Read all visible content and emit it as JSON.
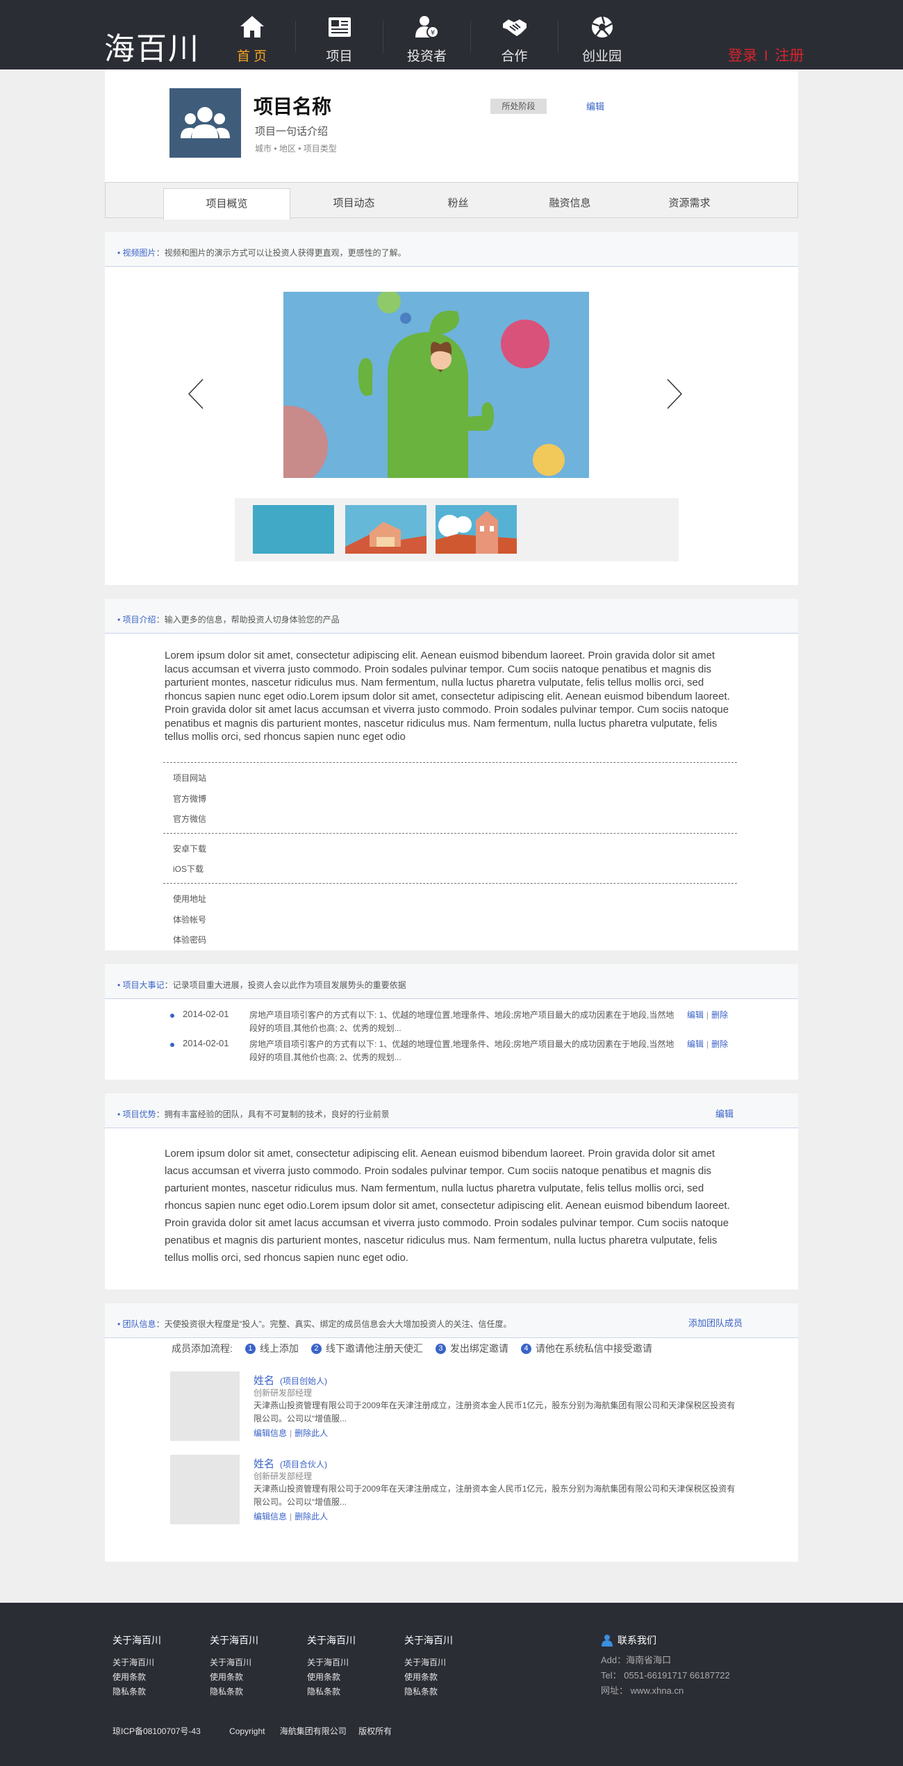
{
  "header": {
    "logo": "海百川",
    "nav": [
      {
        "label": "首 页",
        "icon": "home-icon",
        "active": true
      },
      {
        "label": "项目",
        "icon": "newspaper-icon",
        "active": false
      },
      {
        "label": "投资者",
        "icon": "investor-icon",
        "active": false
      },
      {
        "label": "合作",
        "icon": "handshake-icon",
        "active": false
      },
      {
        "label": "创业园",
        "icon": "aperture-icon",
        "active": false
      }
    ],
    "login": "登录",
    "divider": "I",
    "register": "注册"
  },
  "project": {
    "name": "项目名称",
    "slogan": "项目一句话介绍",
    "meta": "城市 • 地区 • 项目类型",
    "stage": "所处阶段",
    "edit": "编辑"
  },
  "tabs": [
    "项目概览",
    "项目动态",
    "粉丝",
    "融资信息",
    "资源需求"
  ],
  "media": {
    "title": "视频图片",
    "hint": "：视频和图片的演示方式可以让投资人获得更直观，更感性的了解。"
  },
  "intro": {
    "title": "项目介绍",
    "hint": "：输入更多的信息，帮助投资人切身体验您的产品",
    "body": "Lorem ipsum dolor sit amet, consectetur adipiscing elit. Aenean euismod bibendum laoreet. Proin gravida dolor sit amet lacus accumsan et viverra justo commodo. Proin sodales pulvinar tempor. Cum sociis natoque penatibus et magnis dis parturient montes, nascetur ridiculus mus. Nam fermentum, nulla luctus pharetra vulputate, felis tellus mollis orci, sed rhoncus sapien nunc eget odio.Lorem ipsum dolor sit amet, consectetur adipiscing elit. Aenean euismod bibendum laoreet. Proin gravida dolor sit amet lacus accumsan et viverra justo commodo. Proin sodales pulvinar tempor. Cum sociis natoque penatibus et magnis dis parturient montes, nascetur ridiculus mus. Nam fermentum, nulla luctus pharetra vulputate, felis tellus mollis orci, sed rhoncus sapien nunc eget odio",
    "link_groups": [
      [
        "项目网站",
        "官方微博",
        "官方微信"
      ],
      [
        "安卓下载",
        "iOS下载"
      ],
      [
        "使用地址",
        "体验帐号",
        "体验密码"
      ]
    ]
  },
  "events": {
    "title": "项目大事记",
    "hint": "：记录项目重大进展，投资人会以此作为项目发展势头的重要依据",
    "items": [
      {
        "date": "2014-02-01",
        "text": "房地产项目项引客户的方式有以下: 1、优越的地理位置,地理条件、地段;房地产项目最大的成功因素在于地段,当然地段好的项目,其他价也高; 2、优秀的规划...",
        "edit": "编辑",
        "sep": "|",
        "delete": "删除"
      },
      {
        "date": "2014-02-01",
        "text": "房地产项目项引客户的方式有以下: 1、优越的地理位置,地理条件、地段;房地产项目最大的成功因素在于地段,当然地段好的项目,其他价也高; 2、优秀的规划...",
        "edit": "编辑",
        "sep": "|",
        "delete": "删除"
      }
    ]
  },
  "advantage": {
    "title": "项目优势",
    "hint": "：拥有丰富经验的团队，具有不可复制的技术，良好的行业前景",
    "edit": "编辑",
    "body": "Lorem ipsum dolor sit amet, consectetur adipiscing elit. Aenean euismod bibendum laoreet. Proin gravida dolor sit amet lacus accumsan et viverra justo commodo. Proin sodales pulvinar tempor. Cum sociis natoque penatibus et magnis dis parturient montes, nascetur ridiculus mus. Nam fermentum, nulla luctus pharetra vulputate, felis tellus mollis orci, sed rhoncus sapien nunc eget odio.Lorem ipsum dolor sit amet, consectetur adipiscing elit. Aenean euismod bibendum laoreet. Proin gravida dolor sit amet lacus accumsan et viverra justo commodo. Proin sodales pulvinar tempor. Cum sociis natoque penatibus et magnis dis parturient montes, nascetur ridiculus mus. Nam fermentum, nulla luctus pharetra vulputate, felis tellus mollis orci, sed rhoncus sapien nunc eget odio."
  },
  "team": {
    "title": "团队信息",
    "hint": "：天使投资很大程度是“投人”。完整、真实、绑定的成员信息会大大增加投资人的关注、信任度。",
    "add": "添加团队成员",
    "flow_label": "成员添加流程:",
    "steps": [
      {
        "num": "1",
        "label": "线上添加"
      },
      {
        "num": "2",
        "label": "线下邀请他注册天使汇"
      },
      {
        "num": "3",
        "label": "发出绑定邀请"
      },
      {
        "num": "4",
        "label": "请他在系统私信中接受邀请"
      }
    ],
    "members": [
      {
        "name": "姓名",
        "role": "(项目创始人)",
        "position": "创新研发部经理",
        "desc": "天津燕山投资管理有限公司于2009年在天津注册成立，注册资本金人民币1亿元，股东分别为海航集团有限公司和天津保税区投资有限公司。公司以“增值服...",
        "edit": "编辑信息",
        "sep": "|",
        "delete": "删除此人"
      },
      {
        "name": "姓名",
        "role": "(项目合伙人)",
        "position": "创新研发部经理",
        "desc": "天津燕山投资管理有限公司于2009年在天津注册成立，注册资本金人民币1亿元，股东分别为海航集团有限公司和天津保税区投资有限公司。公司以“增值服...",
        "edit": "编辑信息",
        "sep": "|",
        "delete": "删除此人"
      }
    ]
  },
  "footer": {
    "columns": [
      {
        "heading": "关于海百川",
        "links": [
          "关于海百川",
          "使用条款",
          "隐私条款"
        ]
      },
      {
        "heading": "关于海百川",
        "links": [
          "关于海百川",
          "使用条款",
          "隐私条款"
        ]
      },
      {
        "heading": "关于海百川",
        "links": [
          "关于海百川",
          "使用条款",
          "隐私条款"
        ]
      },
      {
        "heading": "关于海百川",
        "links": [
          "关于海百川",
          "使用条款",
          "隐私条款"
        ]
      }
    ],
    "contact": {
      "heading": "联系我们",
      "address": "Add：海南省海口",
      "tel": "Tel：  0551-66191717     66187722",
      "web": "网址：  www.xhna.cn"
    },
    "icp": "琼ICP备08100707号-43",
    "copyright": "Copyright",
    "company": "海航集团有限公司",
    "rights": "版权所有"
  },
  "colors": {
    "accent": "#3a63c8",
    "nav_active": "#f5a623",
    "auth": "#d7242a",
    "dark": "#2b2d35"
  }
}
